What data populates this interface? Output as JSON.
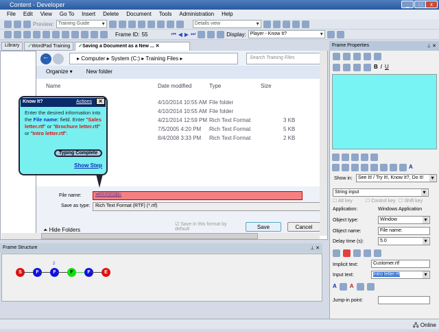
{
  "window": {
    "title": "Content - Developer"
  },
  "menu": [
    "File",
    "Edit",
    "View",
    "Go To",
    "Insert",
    "Delete",
    "Document",
    "Tools",
    "Administration",
    "Help"
  ],
  "toolbar": {
    "preview_label": "Preview:",
    "preview_value": "Training Guide",
    "view_value": "Details view",
    "frame_id_label": "Frame ID:",
    "frame_id": "55",
    "display_label": "Display:",
    "display_value": "Player - Know It?"
  },
  "tabs": [
    {
      "label": "Library"
    },
    {
      "label": "WordPad Training"
    },
    {
      "label": "Saving a Document as a New ..."
    }
  ],
  "dialog": {
    "breadcrumb": [
      "Computer",
      "System (C:)",
      "Training Files"
    ],
    "search_placeholder": "Search Training Files",
    "organize": "Organize ▾",
    "new_folder": "New folder",
    "columns": [
      "Name",
      "Date modified",
      "Type",
      "Size"
    ],
    "rows": [
      {
        "date": "4/10/2014 10:55 AM",
        "type": "File folder",
        "size": ""
      },
      {
        "date": "4/10/2014 10:55 AM",
        "type": "File folder",
        "size": ""
      },
      {
        "date": "4/21/2014 12:59 PM",
        "type": "Rich Text Format",
        "size": "3 KB"
      },
      {
        "date": "7/5/2005 4:20 PM",
        "type": "Rich Text Format",
        "size": "5 KB"
      },
      {
        "date": "8/4/2008 3:33 PM",
        "type": "Rich Text Format",
        "size": "2 KB"
      }
    ],
    "file_name_label": "File name:",
    "file_name_value": "Customer.rtf",
    "save_type_label": "Save as type:",
    "save_type_value": "Rich Text Format (RTF) (*.rtf)",
    "save_default": "Save in this format by default",
    "hide_folders": "Hide Folders",
    "save": "Save",
    "cancel": "Cancel"
  },
  "bubble": {
    "title": "Know It?",
    "actions": "Actions",
    "text_1": "Enter the desired information into the ",
    "field": "File name:",
    "text_2": " field. Enter \"",
    "opt1": "Sales letter.rtf",
    "or1": "\" or \"",
    "opt2": "Brochure letter.rtf",
    "or2": "\" or \"",
    "opt3": "Intro letter.rtf",
    "end": "\".",
    "typing_complete": "Typing Complete",
    "show_step": "Show Step"
  },
  "frame_structure": {
    "title": "Frame Structure",
    "nodes": [
      {
        "l": "S",
        "c": "#e01010"
      },
      {
        "l": "F",
        "c": "#1010e0"
      },
      {
        "l": "F",
        "c": "#1010e0",
        "badge": "2"
      },
      {
        "l": "F",
        "c": "#10e010"
      },
      {
        "l": "F",
        "c": "#1010e0"
      },
      {
        "l": "E",
        "c": "#e01010"
      }
    ]
  },
  "props": {
    "title": "Frame Properties",
    "show_in_label": "Show in:",
    "show_in_value": "See It! / Try It!, Know It?, Do It!",
    "action": "String input",
    "alt": "Alt key",
    "ctrl": "Control key",
    "shift": "Shift key",
    "app_label": "Application:",
    "app_value": "Windows Application",
    "objtype_label": "Object type:",
    "objtype_value": "Window",
    "objname_label": "Object name:",
    "objname_value": "File name:",
    "delay_label": "Delay time (s):",
    "delay_value": "5.0",
    "implicit_label": "Implicit text:",
    "implicit_value": "Customer.rtf",
    "input_label": "Input text:",
    "input_value": "Intro letter.rtf",
    "jump_label": "Jump-in point:",
    "jump_value": ""
  },
  "status": {
    "online": "Online"
  }
}
